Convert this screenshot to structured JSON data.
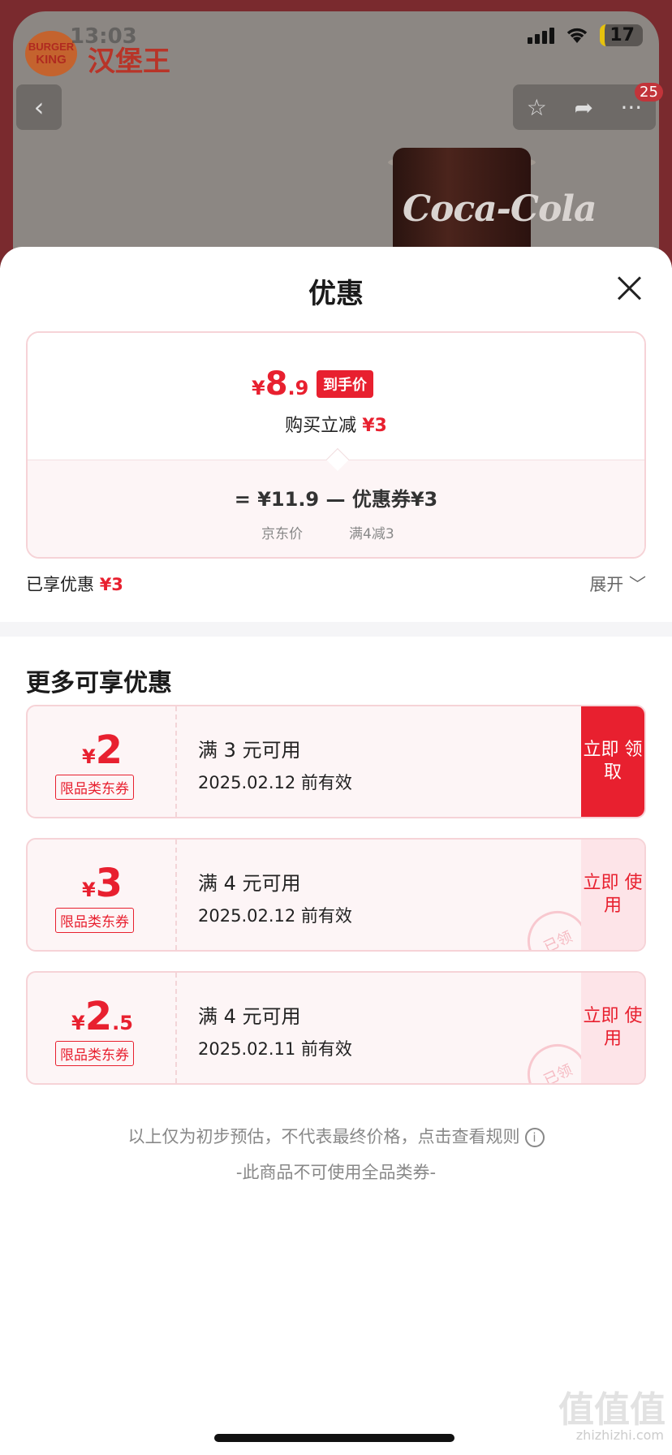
{
  "status": {
    "time": "13:03",
    "battery": "17"
  },
  "header": {
    "brand_logo_text": "BURGER KING",
    "brand_cn": "汉堡王",
    "badge_count": "25",
    "product_text": "Coca-Cola"
  },
  "sheet": {
    "title": "优惠",
    "final_price": {
      "symbol": "¥",
      "integer": "8",
      "decimal": ".9",
      "tag": "到手价"
    },
    "instant_label": "购买立减",
    "instant_amount": "¥3",
    "calc": {
      "text": "=  ¥11.9  —  优惠券¥3",
      "sub1": "京东价",
      "sub2": "满4减3"
    },
    "enjoyed_label": "已享优惠",
    "enjoyed_amount": "¥3",
    "expand_label": "展开 ﹀"
  },
  "more": {
    "title": "更多可享优惠",
    "coupons": [
      {
        "symbol": "¥",
        "amount": "2",
        "decimal": "",
        "type": "限品类东券",
        "condition": "满 3 元可用",
        "date": "2025.02.12 前有效",
        "button": "立即 领取",
        "state": "available"
      },
      {
        "symbol": "¥",
        "amount": "3",
        "decimal": "",
        "type": "限品类东券",
        "condition": "满 4 元可用",
        "date": "2025.02.12 前有效",
        "button": "立即 使用",
        "state": "claimed",
        "stamp": "已领"
      },
      {
        "symbol": "¥",
        "amount": "2",
        "decimal": ".5",
        "type": "限品类东券",
        "condition": "满 4 元可用",
        "date": "2025.02.11 前有效",
        "button": "立即 使用",
        "state": "claimed",
        "stamp": "已领"
      }
    ]
  },
  "footer": {
    "note": "以上仅为初步预估，不代表最终价格，点击查看规则",
    "note2": "-此商品不可使用全品类券-",
    "watermark": "值值值",
    "watermark_url": "zhizhizhi.com"
  }
}
